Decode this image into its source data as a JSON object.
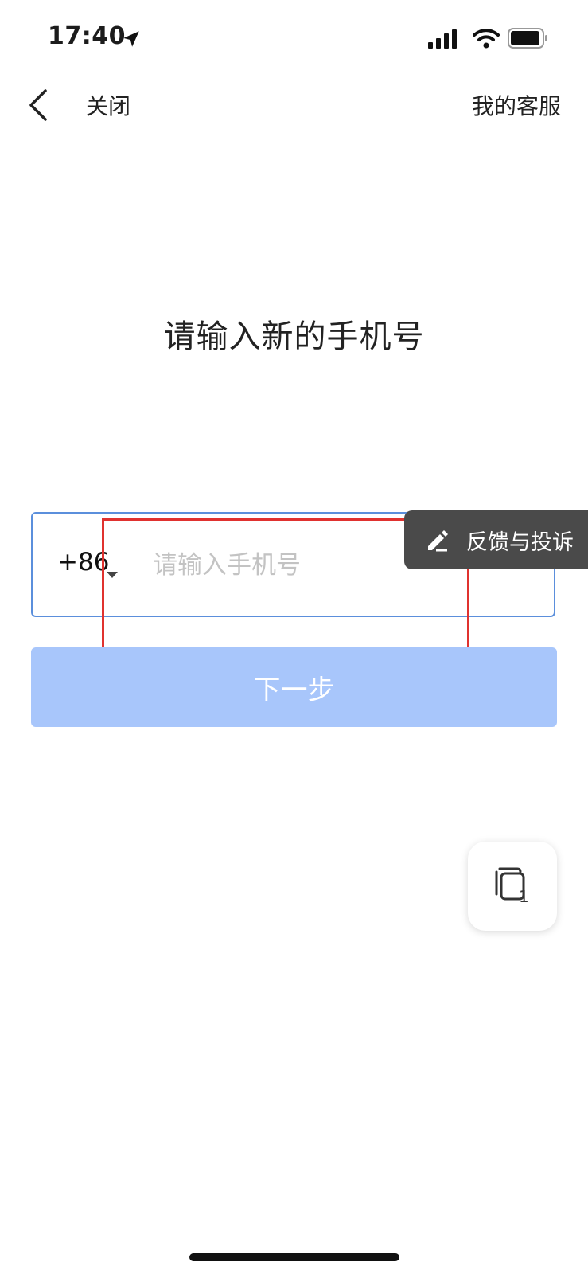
{
  "status_bar": {
    "time": "17:40"
  },
  "nav": {
    "close_label": "关闭",
    "service_label": "我的客服"
  },
  "main": {
    "title": "请输入新的手机号"
  },
  "phone": {
    "country_code": "+86",
    "placeholder": "请输入手机号",
    "value": ""
  },
  "feedback": {
    "label": "反馈与投诉"
  },
  "next_button": {
    "label": "下一步"
  },
  "floating_window": {
    "count": "1"
  },
  "colors": {
    "accent": "#5b8fdc",
    "button_disabled": "#a8c6fb",
    "highlight": "#e0322f",
    "feedback_bg": "#4a4a4a"
  }
}
